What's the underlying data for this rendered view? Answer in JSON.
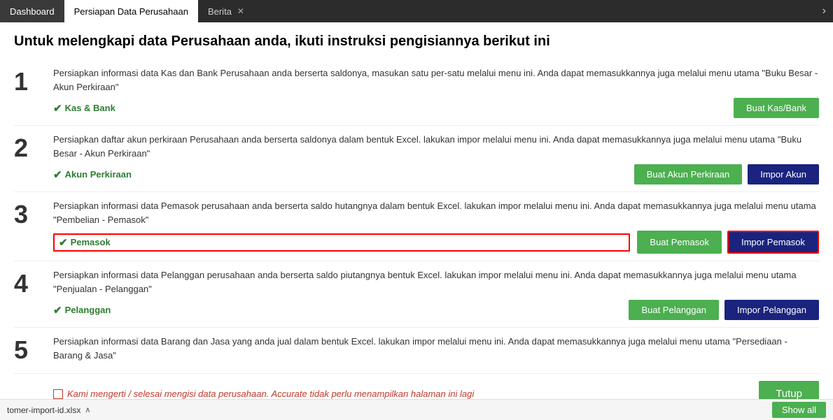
{
  "tabs": [
    {
      "id": "dashboard",
      "label": "Dashboard",
      "active": false,
      "closeable": false
    },
    {
      "id": "persiapan",
      "label": "Persiapan Data Perusahaan",
      "active": true,
      "closeable": false
    },
    {
      "id": "berita",
      "label": "Berita",
      "active": false,
      "closeable": true
    }
  ],
  "tab_overflow": "›",
  "page_title": "Untuk melengkapi data Perusahaan anda, ikuti instruksi pengisiannya berikut ini",
  "steps": [
    {
      "number": "1",
      "description": "Persiapkan informasi data Kas dan Bank Perusahaan anda berserta saldonya, masukan satu per-satu melalui menu ini. Anda dapat memasukkannya juga melalui menu utama \"Buku Besar - Akun Perkiraan\"",
      "link_label": "Kas & Bank",
      "link_red_border": false,
      "buttons": [
        {
          "label": "Buat Kas/Bank",
          "type": "green"
        }
      ]
    },
    {
      "number": "2",
      "description": "Persiapkan daftar akun perkiraan Perusahaan anda berserta saldonya dalam bentuk Excel. lakukan impor melalui menu ini. Anda dapat memasukkannya juga melalui menu utama \"Buku Besar - Akun Perkiraan\"",
      "link_label": "Akun Perkiraan",
      "link_red_border": false,
      "buttons": [
        {
          "label": "Buat Akun Perkiraan",
          "type": "green"
        },
        {
          "label": "Impor Akun",
          "type": "blue"
        }
      ]
    },
    {
      "number": "3",
      "description": "Persiapkan informasi data Pemasok perusahaan anda berserta saldo hutangnya dalam bentuk Excel. lakukan impor melalui menu ini. Anda dapat memasukkannya juga melalui menu utama \"Pembelian - Pemasok\"",
      "link_label": "Pemasok",
      "link_red_border": true,
      "buttons": [
        {
          "label": "Buat Pemasok",
          "type": "green"
        },
        {
          "label": "Impor Pemasok",
          "type": "blue-highlight"
        }
      ]
    },
    {
      "number": "4",
      "description": "Persiapkan informasi data Pelanggan perusahaan anda berserta saldo piutangnya bentuk Excel. lakukan impor melalui menu ini. Anda dapat memasukkannya juga melalui menu utama \"Penjualan - Pelanggan\"",
      "link_label": "Pelanggan",
      "link_red_border": false,
      "buttons": [
        {
          "label": "Buat Pelanggan",
          "type": "green"
        },
        {
          "label": "Impor Pelanggan",
          "type": "blue"
        }
      ]
    },
    {
      "number": "5",
      "description": "Persiapkan informasi data Barang dan Jasa yang anda jual dalam bentuk Excel. lakukan impor melalui menu ini. Anda dapat memasukkannya juga melalui menu utama \"Persediaan - Barang & Jasa\"",
      "link_label": null,
      "link_red_border": false,
      "buttons": []
    }
  ],
  "footer": {
    "checkbox_label": "Kami mengerti / selesai mengisi data perusahaan. Accurate tidak perlu menampilkan halaman ini lagi",
    "tutup_label": "Tutup"
  },
  "status_bar": {
    "file_name": "tomer-import-id.xlsx",
    "show_all_label": "Show all"
  }
}
